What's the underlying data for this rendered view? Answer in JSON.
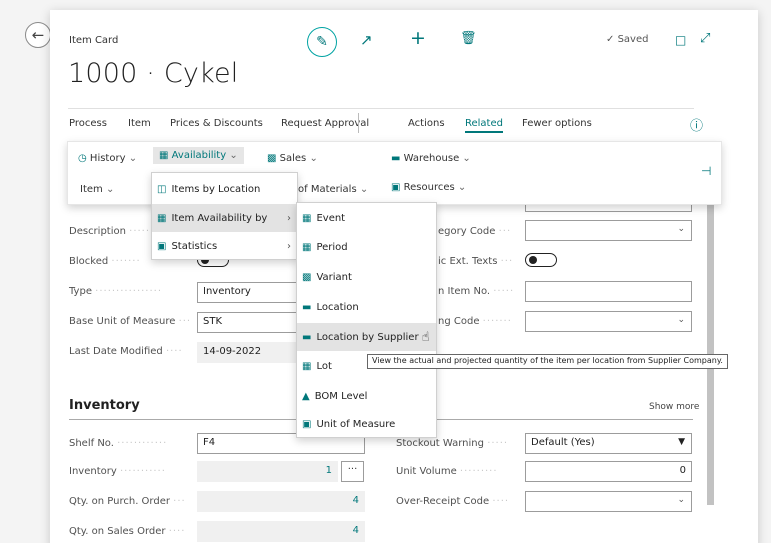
{
  "header": {
    "breadcrumb": "Item Card",
    "title": "1000 · Cykel",
    "saved": "Saved"
  },
  "actions": {
    "process": "Process",
    "item": "Item",
    "prices": "Prices & Discounts",
    "request": "Request Approval",
    "actions": "Actions",
    "related": "Related",
    "fewer": "Fewer options"
  },
  "submenu": {
    "history": "History",
    "availability": "Availability",
    "sales": "Sales",
    "warehouse": "Warehouse",
    "item": "Item",
    "bom": "of Materials",
    "resources": "Resources"
  },
  "availability_menu": {
    "items_by_location": "Items by Location",
    "item_availability_by": "Item Availability by",
    "statistics": "Statistics"
  },
  "availability_by_menu": {
    "event": "Event",
    "period": "Period",
    "variant": "Variant",
    "location": "Location",
    "location_by_supplier": "Location by Supplier",
    "lot": "Lot",
    "bom_level": "BOM Level",
    "unit_of_measure": "Unit of Measure"
  },
  "tooltip": "View the actual and projected quantity of the item per location from Supplier Company.",
  "general": {
    "description_label": "Description",
    "blocked_label": "Blocked",
    "type_label": "Type",
    "type_value": "Inventory",
    "base_uom_label": "Base Unit of Measure",
    "base_uom_value": "STK",
    "last_modified_label": "Last Date Modified",
    "last_modified_value": "14-09-2022",
    "category_code_label": "egory Code",
    "ext_texts_label": "ic Ext. Texts",
    "item_no_label": "n Item No.",
    "ng_code_label": "ng Code"
  },
  "inventory": {
    "section_title": "Inventory",
    "show_more": "Show more",
    "shelf_label": "Shelf No.",
    "shelf_value": "F4",
    "inventory_label": "Inventory",
    "inventory_value": "1",
    "purch_label": "Qty. on Purch. Order",
    "purch_value": "4",
    "sales_label": "Qty. on Sales Order",
    "sales_value": "4",
    "stockout_label": "Stockout Warning",
    "stockout_value": "Default (Yes)",
    "unit_volume_label": "Unit Volume",
    "unit_volume_value": "0",
    "over_receipt_label": "Over-Receipt Code"
  },
  "colors": {
    "accent": "#00777a",
    "highlight": "#e3e3e3"
  }
}
